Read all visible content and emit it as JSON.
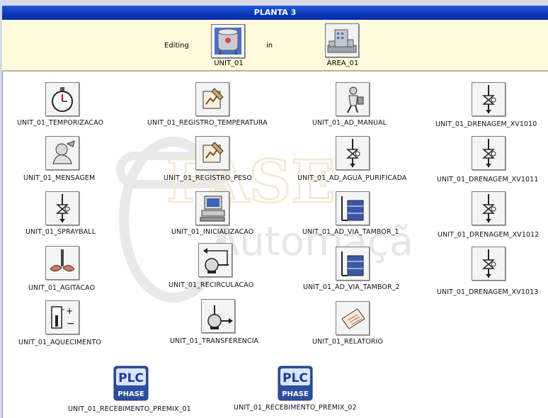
{
  "window": {
    "title": "PLANTA 3"
  },
  "editbar": {
    "editing_label": "Editing",
    "in_label": "in",
    "unit_caption": "UNIT_01",
    "area_caption": "ÁREA_01"
  },
  "watermark": {
    "word1": "FASE",
    "word2": "Automação"
  },
  "items": [
    {
      "label": "UNIT_01_TEMPORIZACAO",
      "icon": "stopwatch-icon"
    },
    {
      "label": "UNIT_01_MENSAGEM",
      "icon": "message-icon"
    },
    {
      "label": "UNIT_01_SPRAYBALL",
      "icon": "valve-icon"
    },
    {
      "label": "UNIT_01_AGITACAO",
      "icon": "agitator-icon"
    },
    {
      "label": "UNIT_01_AQUECIMENTO",
      "icon": "thermometer-icon"
    },
    {
      "label": "UNIT_01_REGISTRO_TEMPERATURA",
      "icon": "record-icon"
    },
    {
      "label": "UNIT_01_REGISTRO_PESO",
      "icon": "record-icon"
    },
    {
      "label": "UNIT_01_INICIALIZACAO",
      "icon": "computer-icon"
    },
    {
      "label": "UNIT_01_RECIRCULACAO",
      "icon": "pump-recirculation-icon"
    },
    {
      "label": "UNIT_01_TRANSFERENCIA",
      "icon": "pump-transfer-icon"
    },
    {
      "label": "UNIT_01_AD_MANUAL",
      "icon": "operator-icon"
    },
    {
      "label": "UNIT_01_AD_AGUA_PURIFICADA",
      "icon": "valve-icon"
    },
    {
      "label": "UNIT_01_AD_VIA_TAMBOR_1",
      "icon": "drum-icon"
    },
    {
      "label": "UNIT_01_AD_VIA_TAMBOR_2",
      "icon": "drum-icon"
    },
    {
      "label": "UNIT_01_RELATORIO",
      "icon": "report-icon"
    },
    {
      "label": "UNIT_01_DRENAGEM_XV1010",
      "icon": "valve-icon"
    },
    {
      "label": "UNIT_01_DRENAGEM_XV1011",
      "icon": "valve-icon"
    },
    {
      "label": "UNIT_01_DRENAGEM_XV1012",
      "icon": "valve-icon"
    },
    {
      "label": "UNIT_01_DRENAGEM_XV1013",
      "icon": "valve-icon"
    },
    {
      "label": "UNIT_01_RECEBIMENTO_PREMIX_01",
      "icon": "plc-phase-icon",
      "badge_top": "PLC",
      "badge_bottom": "PHASE"
    },
    {
      "label": "UNIT_01_RECEBIMENTO_PREMIX_02",
      "icon": "plc-phase-icon",
      "badge_top": "PLC",
      "badge_bottom": "PHASE"
    }
  ]
}
